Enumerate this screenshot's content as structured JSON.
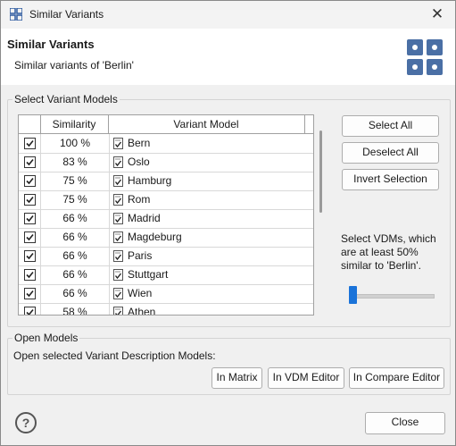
{
  "window": {
    "title": "Similar Variants"
  },
  "header": {
    "title": "Similar Variants",
    "subtitle": "Similar variants of 'Berlin'"
  },
  "select_group": {
    "label": "Select Variant Models",
    "columns": [
      "Similarity",
      "Variant Model"
    ],
    "rows": [
      {
        "checked": true,
        "similarity": "100 %",
        "name": "Bern"
      },
      {
        "checked": true,
        "similarity": "83 %",
        "name": "Oslo"
      },
      {
        "checked": true,
        "similarity": "75 %",
        "name": "Hamburg"
      },
      {
        "checked": true,
        "similarity": "75 %",
        "name": "Rom"
      },
      {
        "checked": true,
        "similarity": "66 %",
        "name": "Madrid"
      },
      {
        "checked": true,
        "similarity": "66 %",
        "name": "Magdeburg"
      },
      {
        "checked": true,
        "similarity": "66 %",
        "name": "Paris"
      },
      {
        "checked": true,
        "similarity": "66 %",
        "name": "Stuttgart"
      },
      {
        "checked": true,
        "similarity": "66 %",
        "name": "Wien"
      },
      {
        "checked": true,
        "similarity": "58 %",
        "name": "Athen"
      }
    ],
    "buttons": {
      "select_all": "Select All",
      "deselect_all": "Deselect All",
      "invert": "Invert Selection"
    },
    "hint": "Select VDMs, which are at least  50% similar to 'Berlin'.",
    "slider_value_percent": 50
  },
  "open_group": {
    "label": "Open Models",
    "text": "Open selected Variant Description Models:",
    "buttons": {
      "matrix": "In Matrix",
      "vdm_editor": "In VDM Editor",
      "compare_editor": "In Compare Editor"
    }
  },
  "footer": {
    "close": "Close",
    "help": "?"
  },
  "colors": {
    "accent": "#1a73d9",
    "icon_blue": "#4a6fa5"
  }
}
